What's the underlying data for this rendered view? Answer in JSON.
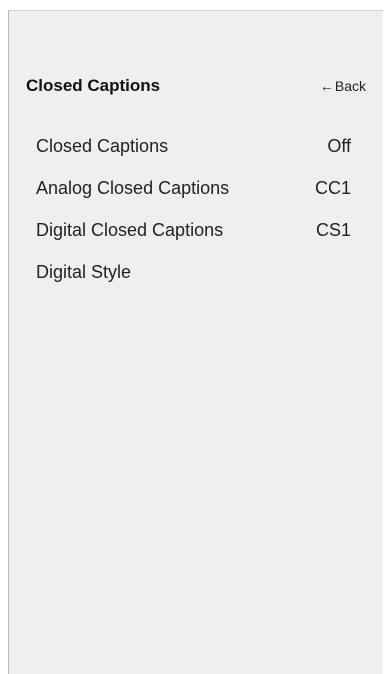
{
  "header": {
    "title": "Closed Captions",
    "back_label": "Back",
    "back_icon": "left-arrow-icon"
  },
  "menu": {
    "items": [
      {
        "label": "Closed Captions",
        "value": "Off"
      },
      {
        "label": "Analog Closed Captions",
        "value": "CC1"
      },
      {
        "label": "Digital Closed Captions",
        "value": "CS1"
      },
      {
        "label": "Digital Style",
        "value": ""
      }
    ]
  },
  "colors": {
    "panel_background": "#efefef",
    "text": "#222222"
  }
}
